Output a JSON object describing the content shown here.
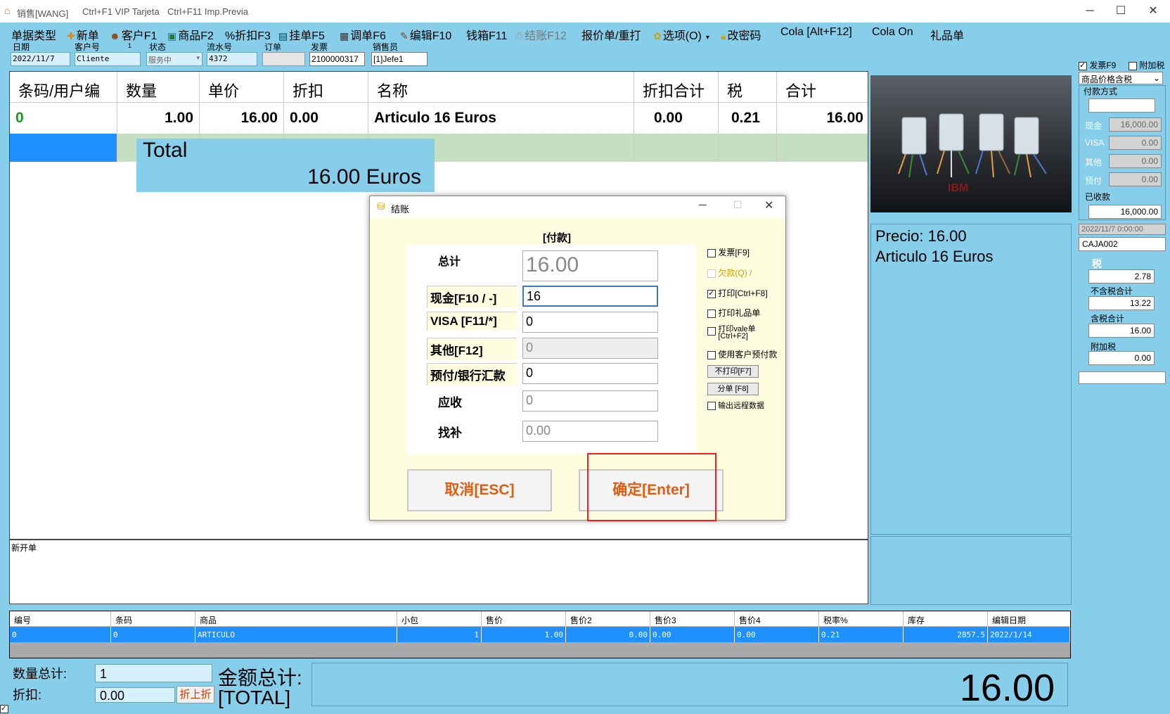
{
  "titlebar": {
    "app_title": "销售[WANG]",
    "hint1": "Ctrl+F1 VIP Tarjeta",
    "hint2": "Ctrl+F11 Imp.Previa",
    "minimize": "─",
    "maximize": "☐",
    "close": "✕"
  },
  "toolbar": {
    "doc_type": "单据类型",
    "new": "新单",
    "customer": "客户F1",
    "product": "商品F2",
    "discount": "%折扣F3",
    "hold": "挂单F5",
    "recall": "调单F6",
    "edit": "编辑F10",
    "drawer": "钱箱F11",
    "checkout": "结账F12",
    "quote": "报价单/重打",
    "options": "选项(O)",
    "password": "改密码",
    "cola": "Cola [Alt+F12]",
    "cola_on": "Cola On",
    "gift": "礼品单"
  },
  "header": {
    "date_label": "日期",
    "date_value": "2022/11/7",
    "customer_label": "客户号",
    "customer_num": "1",
    "customer_value": "Cliente",
    "status_label": "状态",
    "status_value": "服务中",
    "serial_label": "流水号",
    "serial_value": "4372",
    "order_label": "订单",
    "order_value": "",
    "invoice_label": "发票",
    "invoice_value": "2100000317",
    "seller_label": "销售员",
    "seller_value": "[1]Jefe1"
  },
  "grid": {
    "headers": [
      "条码/用户编",
      "数量",
      "单价",
      "折扣",
      "名称",
      "折扣合计",
      "税",
      "合计"
    ],
    "rows": [
      {
        "code": "0",
        "qty": "1.00",
        "price": "16.00",
        "discount": "0.00",
        "name": "Articulo 16 Euros",
        "disc_total": "0.00",
        "tax": "0.21",
        "total": "16.00"
      }
    ],
    "total_label": "Total",
    "total_value": "16.00 Euros"
  },
  "note": {
    "text": "新开单"
  },
  "product_list": {
    "headers": [
      "编号",
      "条码",
      "商品",
      "小包",
      "售价",
      "售价2",
      "售价3",
      "售价4",
      "税率%",
      "库存",
      "编辑日期"
    ],
    "row": [
      "0",
      "0",
      "ARTICULO",
      "1",
      "1.00",
      "0.00",
      "0.00",
      "0.00",
      "0.21",
      "2857.5",
      "2022/1/14"
    ]
  },
  "bottom": {
    "qty_total_label": "数量总计:",
    "qty_total_value": "1",
    "discount_label": "折扣:",
    "discount_value": "0.00",
    "discount_button": "折上折",
    "amount_label_1": "金额总计:",
    "amount_label_2": "[TOTAL]",
    "amount_value": "16.00"
  },
  "right_panel": {
    "invoice_cb": "发票F9",
    "surtax_cb": "附加税",
    "price_mode": "商品价格含税",
    "payment_label": "付款方式",
    "cash_label": "现金",
    "cash_value": "16,000.00",
    "visa_label": "VISA",
    "visa_value": "0.00",
    "other_label": "其他",
    "other_value": "0.00",
    "prepaid_label": "预付",
    "prepaid_value": "0.00",
    "received_label": "已收款",
    "received_value": "16,000.00",
    "datetime": "2022/11/7 0:00:00",
    "caja": "CAJA002",
    "tax_label": "税",
    "tax_value": "2.78",
    "pretax_label": "不含税合计",
    "pretax_value": "13.22",
    "withtax_label": "含税合计",
    "withtax_value": "16.00",
    "surtax_label": "附加税",
    "surtax_value": "0.00",
    "price_info": "Precio: 16.00",
    "name_info": "Articulo 16 Euros"
  },
  "dialog": {
    "title": "结账",
    "heading": "[付款]",
    "total_label": "总计",
    "total_value": "16.00",
    "cash_label": "现金[F10 / -]",
    "cash_value": "16",
    "visa_label": "VISA [F11/*]",
    "visa_value": "0",
    "other_label": "其他[F12]",
    "other_value": "0",
    "prepaid_label": "预付/银行汇款",
    "prepaid_value": "0",
    "receivable_label": "应收",
    "receivable_value": "0",
    "change_label": "找补",
    "change_value": "0.00",
    "cb_invoice": "发票[F9]",
    "cb_debt": "欠款(Q) /",
    "cb_print": "打印[Ctrl+F8]",
    "cb_gift": "打印礼品单",
    "cb_vale_1": "打印vale单",
    "cb_vale_2": "[Ctrl+F2]",
    "cb_prepaid": "使用客户预付款",
    "btn_noprint": "不打印[F7]",
    "btn_split": "分单 [F8]",
    "cb_export": "输出远程数据",
    "cancel": "取消[ESC]",
    "confirm": "确定[Enter]"
  }
}
